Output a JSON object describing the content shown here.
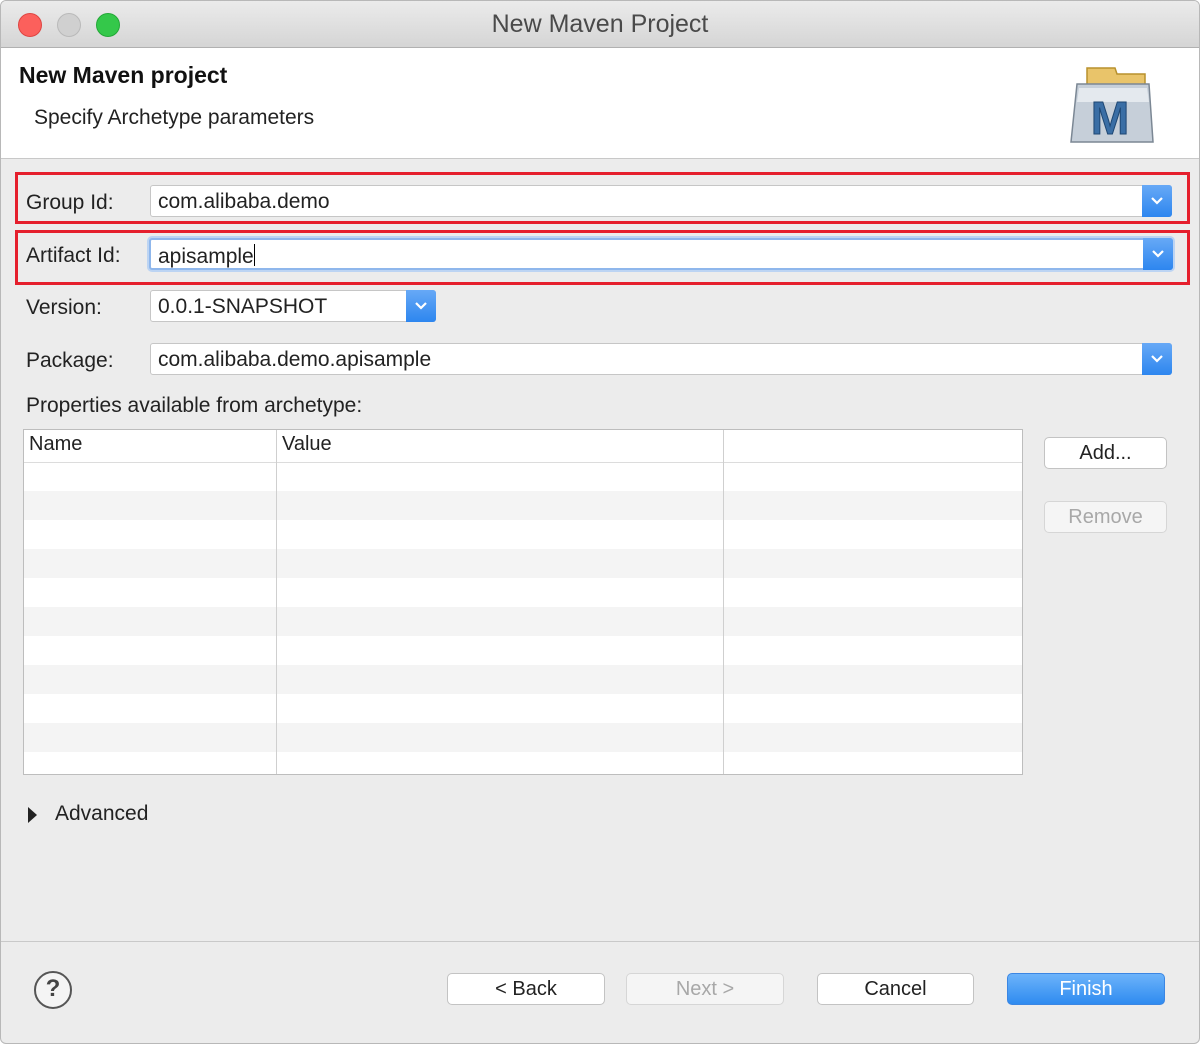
{
  "window": {
    "title": "New Maven Project"
  },
  "header": {
    "title": "New Maven project",
    "subtitle": "Specify Archetype parameters",
    "logo_text": "M"
  },
  "form": {
    "group_id": {
      "label": "Group Id:",
      "value": "com.alibaba.demo"
    },
    "artifact_id": {
      "label": "Artifact Id:",
      "value": "apisample"
    },
    "version": {
      "label": "Version:",
      "value": "0.0.1-SNAPSHOT"
    },
    "package": {
      "label": "Package:",
      "value": "com.alibaba.demo.apisample"
    }
  },
  "properties": {
    "label": "Properties available from archetype:",
    "columns": [
      "Name",
      "Value"
    ],
    "rows": []
  },
  "buttons": {
    "add": "Add...",
    "remove": "Remove",
    "back": "< Back",
    "next": "Next >",
    "cancel": "Cancel",
    "finish": "Finish"
  },
  "advanced": {
    "label": "Advanced"
  },
  "help": {
    "icon": "?"
  },
  "colors": {
    "highlight": "#e51f2d",
    "accent": "#2f8bf0"
  }
}
